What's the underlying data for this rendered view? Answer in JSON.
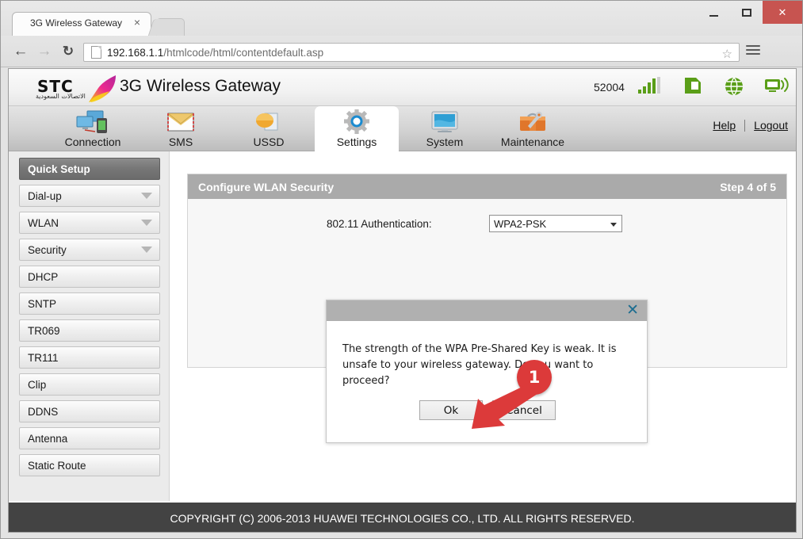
{
  "browser": {
    "tab_title": "3G Wireless Gateway",
    "tab_close": "×",
    "back_icon": "←",
    "forward_icon": "→",
    "reload_icon": "↻",
    "url_host": "192.168.1.1",
    "url_path": "/htmlcode/html/contentdefault.asp",
    "star_icon": "☆",
    "minimize_label": "–",
    "maximize_label": "□",
    "close_label": "✕"
  },
  "router": {
    "logo_word": "STC",
    "logo_arabic": "الاتصالات السعودية",
    "brand_title": "3G Wireless Gateway",
    "device_id": "52004",
    "status_icons": [
      {
        "name": "signal-strength-icon",
        "color": "#5a9e18"
      },
      {
        "name": "sim-card-icon",
        "color": "#5a9e18"
      },
      {
        "name": "internet-globe-icon",
        "color": "#5a9e18"
      },
      {
        "name": "wifi-broadcast-icon",
        "color": "#5a9e18"
      }
    ],
    "nav_tabs": [
      {
        "label": "Connection",
        "icon": "connection-icon",
        "active": false
      },
      {
        "label": "SMS",
        "icon": "sms-envelope-icon",
        "active": false
      },
      {
        "label": "USSD",
        "icon": "ussd-icon",
        "active": false
      },
      {
        "label": "Settings",
        "icon": "settings-gear-icon",
        "active": true
      },
      {
        "label": "System",
        "icon": "system-monitor-icon",
        "active": false
      },
      {
        "label": "Maintenance",
        "icon": "maintenance-toolbox-icon",
        "active": false
      }
    ],
    "help_label": "Help",
    "logout_label": "Logout",
    "sidebar": [
      {
        "label": "Quick Setup",
        "active": true,
        "expandable": false
      },
      {
        "label": "Dial-up",
        "active": false,
        "expandable": true
      },
      {
        "label": "WLAN",
        "active": false,
        "expandable": true
      },
      {
        "label": "Security",
        "active": false,
        "expandable": true
      },
      {
        "label": "DHCP",
        "active": false,
        "expandable": false
      },
      {
        "label": "SNTP",
        "active": false,
        "expandable": false
      },
      {
        "label": "TR069",
        "active": false,
        "expandable": false
      },
      {
        "label": "TR111",
        "active": false,
        "expandable": false
      },
      {
        "label": "Clip",
        "active": false,
        "expandable": false
      },
      {
        "label": "DDNS",
        "active": false,
        "expandable": false
      },
      {
        "label": "Antenna",
        "active": false,
        "expandable": false
      },
      {
        "label": "Static Route",
        "active": false,
        "expandable": false
      }
    ],
    "panel": {
      "title": "Configure WLAN Security",
      "step": "Step 4 of 5",
      "auth_label": "802.11 Authentication:",
      "auth_value": "WPA2-PSK"
    },
    "footer": "COPYRIGHT (C) 2006-2013 HUAWEI TECHNOLOGIES CO., LTD. ALL RIGHTS RESERVED."
  },
  "dialog": {
    "close_icon": "✕",
    "message": "The strength of the WPA Pre-Shared Key is weak. It is unsafe to your wireless gateway. Do you want to proceed?",
    "ok_label": "Ok",
    "cancel_label": "Cancel"
  },
  "annotation": {
    "badge_number": "1",
    "color": "#dc3a3a"
  }
}
